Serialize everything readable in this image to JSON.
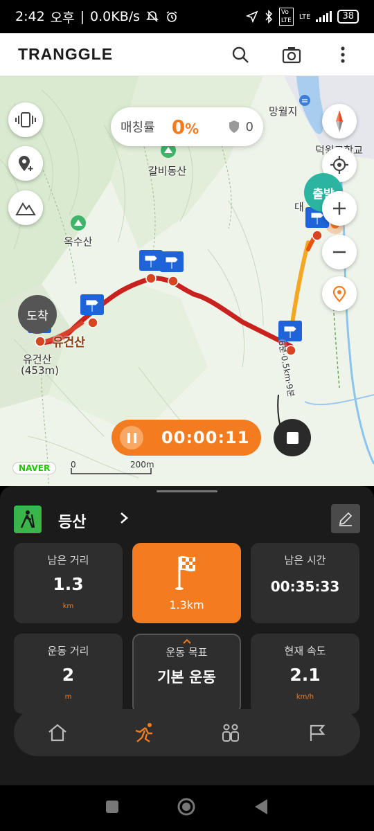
{
  "status_bar": {
    "time": "2:42",
    "ampm": "오후",
    "speed": "0.0KB/s",
    "network": "LTE",
    "battery": "38"
  },
  "header": {
    "logo": "TRANGGLE",
    "icons": [
      "search-icon",
      "camera-icon",
      "more-vert-icon"
    ]
  },
  "map": {
    "match_label": "매칭률",
    "match_value": "0",
    "match_unit": "%",
    "shield_count": "0",
    "places": {
      "mangwolji": "망월지",
      "school": "덕원고학교",
      "galbidongsan": "갈비동산",
      "oksusan": "옥수산",
      "yugeonsan_top": "유건산",
      "yugeonsan": "유건산",
      "yugeonsan_elev": "(453m)",
      "dae": "대",
      "route_note": "6분·0.5km·9분"
    },
    "start_badge": "출발",
    "finish_badge": "도착",
    "timer": "00:00:11",
    "naver": "NAVER",
    "scale_zero": "0",
    "scale_len": "200m"
  },
  "panel": {
    "activity": "등산",
    "cards": {
      "remaining_distance": {
        "label": "남은 거리",
        "value": "1.3",
        "unit": "km"
      },
      "goal": {
        "value": "1.3km"
      },
      "remaining_time": {
        "label": "남은 시간",
        "value": "00:35:33"
      },
      "exercise_distance": {
        "label": "운동 거리",
        "value": "2",
        "unit": "m"
      },
      "exercise_goal": {
        "label": "운동 목표",
        "value": "기본 운동"
      },
      "current_speed": {
        "label": "현재 속도",
        "value": "2.1",
        "unit": "km/h"
      }
    },
    "tabs": [
      "home-icon",
      "running-icon",
      "group-icon",
      "flag-icon"
    ],
    "accent": "#f47c20"
  }
}
